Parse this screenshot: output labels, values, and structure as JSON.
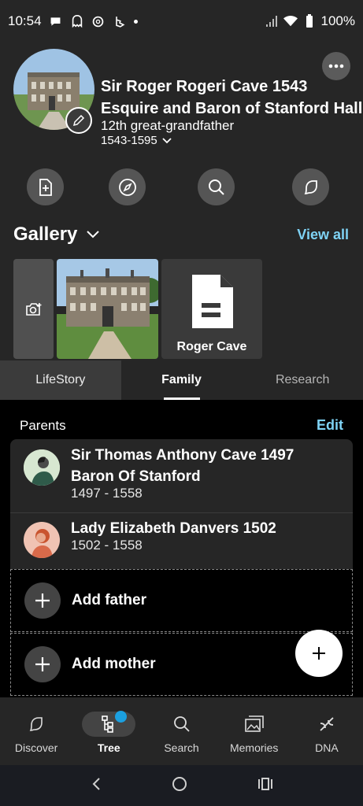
{
  "status_bar": {
    "time": "10:54",
    "battery": "100%"
  },
  "profile": {
    "name_line1": "Sir Roger Rogeri Cave 1543",
    "name_line2": "Esquire and Baron of Stanford Hall",
    "relation": "12th great-grandfather",
    "years": "1543-1595"
  },
  "actions": [
    "add-record-icon",
    "compass-icon",
    "search-icon",
    "chat-icon"
  ],
  "gallery": {
    "title": "Gallery",
    "view_all": "View all",
    "doc_label": "Roger Cave"
  },
  "tabs": [
    "LifeStory",
    "Family",
    "Research"
  ],
  "parents": {
    "label": "Parents",
    "edit": "Edit",
    "people": [
      {
        "name1": "Sir Thomas Anthony Cave 1497",
        "name2": "Baron Of Stanford",
        "years": "1497 - 1558"
      },
      {
        "name1": "Lady Elizabeth Danvers 1502",
        "years": "1502 - 1558"
      }
    ],
    "add_father": "Add father",
    "add_mother": "Add mother"
  },
  "bottom_nav": [
    {
      "label": "Discover",
      "icon": "discover-icon"
    },
    {
      "label": "Tree",
      "icon": "tree-icon",
      "active": true
    },
    {
      "label": "Search",
      "icon": "search-icon"
    },
    {
      "label": "Memories",
      "icon": "memories-icon"
    },
    {
      "label": "DNA",
      "icon": "dna-icon"
    }
  ],
  "colors": {
    "accent": "#7fd3f5",
    "surface": "#262626",
    "badge": "#1ba0e0"
  }
}
